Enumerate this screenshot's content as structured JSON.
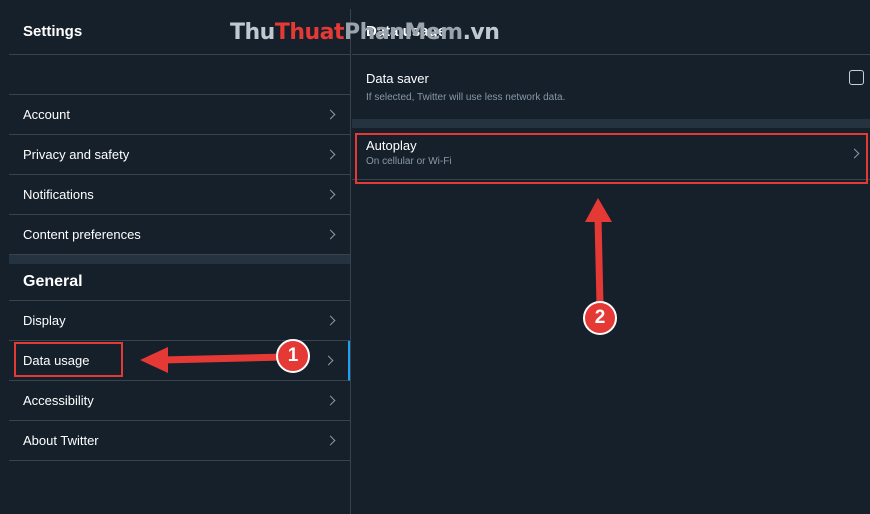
{
  "settings": {
    "title": "Settings",
    "items": [
      {
        "label": "Account"
      },
      {
        "label": "Privacy and safety"
      },
      {
        "label": "Notifications"
      },
      {
        "label": "Content preferences"
      }
    ],
    "general_title": "General",
    "general_items": [
      {
        "label": "Display"
      },
      {
        "label": "Data usage"
      },
      {
        "label": "Accessibility"
      },
      {
        "label": "About Twitter"
      }
    ]
  },
  "data_usage": {
    "title": "Data usage",
    "data_saver_label": "Data saver",
    "data_saver_desc": "If selected, Twitter will use less network data.",
    "data_saver_checked": false,
    "autoplay_title": "Autoplay",
    "autoplay_sub": "On cellular or Wi-Fi"
  },
  "watermark": {
    "part1": "Thu",
    "part2": "Thuat",
    "part3": "PhanMem",
    "part4": ".vn"
  },
  "annotations": {
    "step1": "1",
    "step2": "2"
  },
  "colors": {
    "background": "#15202b",
    "border": "#38444d",
    "accent": "#1da1f2",
    "annotation_red": "#e53935",
    "secondary_text": "#8899a6"
  }
}
